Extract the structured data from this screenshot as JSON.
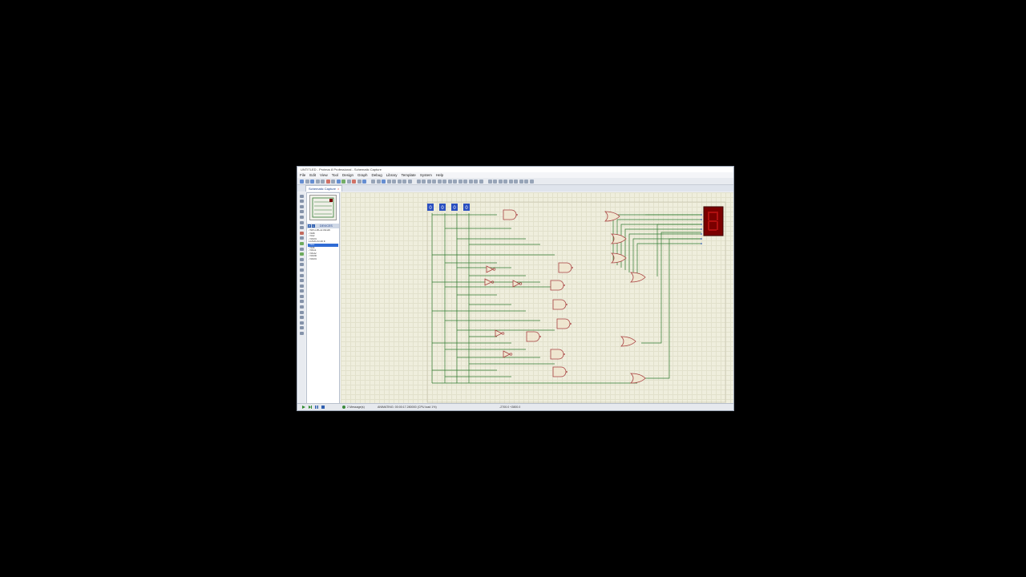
{
  "window": {
    "title": "UNTITLED - Proteus 8 Professional - Schematic Capture"
  },
  "menu": [
    "File",
    "Edit",
    "View",
    "Tool",
    "Design",
    "Graph",
    "Debug",
    "Library",
    "Template",
    "System",
    "Help"
  ],
  "tab": {
    "label": "Schematic Capture",
    "close": "×"
  },
  "devices": {
    "pick_label": "P",
    "lock_label": "L",
    "header": "DEVICES",
    "items": [
      "7SEG-BCD-BLUE",
      "7408",
      "7432",
      "74S04",
      "LOGICSTATE",
      "7411",
      "7404",
      "74S11",
      "74S32",
      "74S08",
      "74S04"
    ],
    "selected_index": 5
  },
  "probes": [
    "0",
    "0",
    "0",
    "0"
  ],
  "status": {
    "messages": "2 Message(s)",
    "animating": "ANIMATING: 00:00:17.280000 (CPU load 1%)",
    "coords": "-2700.0   +2800.0"
  },
  "colors": {
    "wire": "#2f7a2f",
    "gate": "#a84040",
    "display_bg": "#7a0000",
    "probe": "#2a4fc0"
  }
}
